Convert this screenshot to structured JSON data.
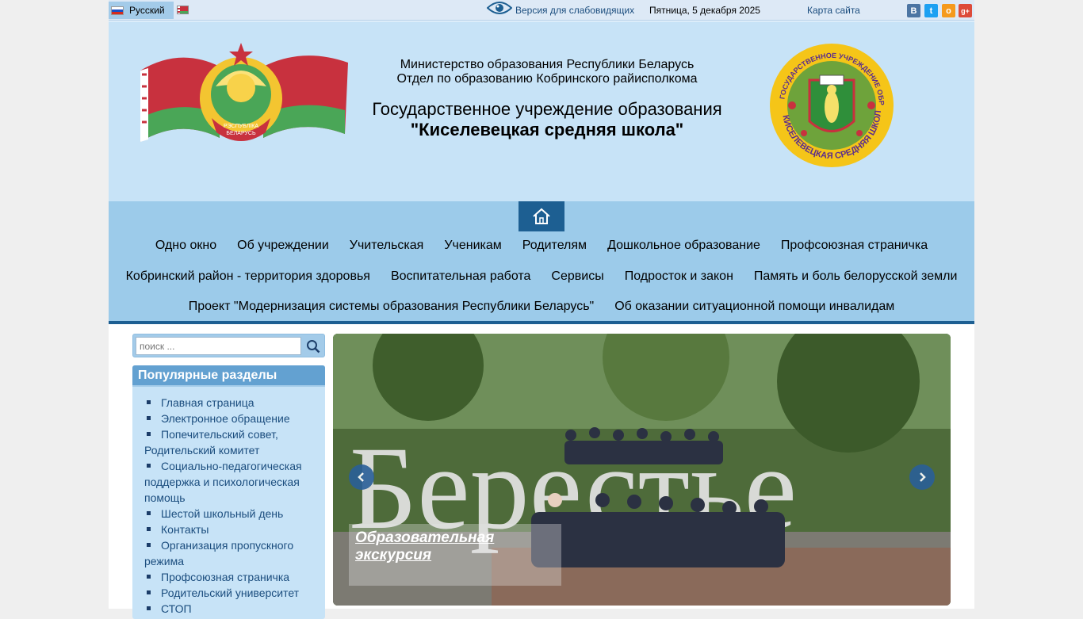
{
  "topbar": {
    "language": "Русский",
    "low_vision": "Версия для слабовидящих",
    "date": "Пятница, 5 декабря 2025",
    "sitemap": "Карта сайта",
    "social": [
      {
        "icon": "vk-icon",
        "glyph": "B",
        "color": "#4c75a3"
      },
      {
        "icon": "twitter-icon",
        "glyph": "t",
        "color": "#1da1f2"
      },
      {
        "icon": "odnoklassniki-icon",
        "glyph": "o",
        "color": "#f59a1d"
      },
      {
        "icon": "google-plus-icon",
        "glyph": "g+",
        "color": "#dd4b39"
      }
    ]
  },
  "header": {
    "ministry": "Министерство образования Республики Беларусь",
    "department": "Отдел по образованию Кобринского райисполкома",
    "title": "Государственное учреждение образования",
    "school": "\"Киселевецкая средняя школа\"",
    "emblem_text": "РЭСПУБЛІКА БЕЛАРУСЬ",
    "logo_text": "ГОСУДАРСТВЕННОЕ УЧРЕЖДЕНИЕ ОБРАЗОВАНИЯ КИСЕЛЕВЕЦКАЯ СРЕДНЯЯ ШКОЛА"
  },
  "nav": {
    "row1": [
      "Одно окно",
      "Об учреждении",
      "Учительская",
      "Ученикам",
      "Родителям",
      "Дошкольное образование",
      "Профсоюзная страничка"
    ],
    "row2": [
      "Кобринский район - территория здоровья",
      "Воспитательная работа",
      "Сервисы",
      "Подросток и закон",
      "Память и боль белорусской земли"
    ],
    "row3": [
      "Проект \"Модернизация системы образования Республики Беларусь\"",
      "Об оказании ситуационной помощи инвалидам"
    ]
  },
  "search": {
    "placeholder": "поиск ..."
  },
  "popular": {
    "title": "Популярные разделы",
    "items": [
      "Главная страница",
      "Электронное обращение",
      "Попечительский совет, Родительский комитет",
      "Социально-педагогическая поддержка и психологическая помощь",
      "Шестой школьный день",
      "Контакты",
      "Организация пропускного режима",
      "Профсоюзная страничка",
      "Родительский университет",
      "СТОП"
    ]
  },
  "slider": {
    "caption": "Образовательная экскурсия",
    "sign_text": "Берестье"
  },
  "colors": {
    "header_bg": "#c7e3f7",
    "nav_bg": "#9ccbea",
    "accent": "#1d5f92",
    "link": "#1b4d7e"
  }
}
